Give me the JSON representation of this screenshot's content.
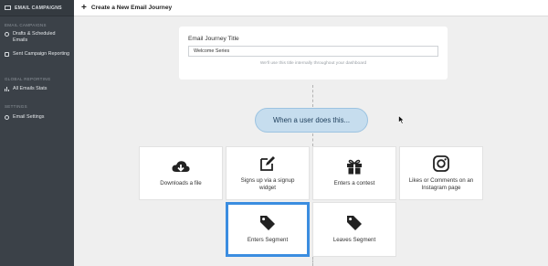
{
  "sidebar": {
    "header": "EMAIL CAMPAIGNS",
    "sections": [
      {
        "title": "EMAIL CAMPAIGNS",
        "items": [
          "Drafts & Scheduled Emails",
          "Sent Campaign Reporting"
        ]
      },
      {
        "title": "GLOBAL REPORTING",
        "items": [
          "All Emails Stats"
        ]
      },
      {
        "title": "SETTINGS",
        "items": [
          "Email Settings"
        ]
      }
    ]
  },
  "topbar": {
    "title": "Create a New Email Journey",
    "icon": "plus-icon"
  },
  "journey_title": {
    "label": "Email Journey Title",
    "value": "Welcome Series",
    "hint": "We'll use this title internally throughout your dashboard"
  },
  "trigger": {
    "label": "When a user does this..."
  },
  "options": [
    {
      "label": "Downloads a file",
      "icon": "cloud-download-icon"
    },
    {
      "label": "Signs up via a signup widget",
      "icon": "edit-icon"
    },
    {
      "label": "Enters a contest",
      "icon": "gift-icon"
    },
    {
      "label": "Likes or Comments on an Instagram page",
      "icon": "instagram-icon"
    },
    {
      "label": "Enters Segment",
      "icon": "tag-icon",
      "selected": true
    },
    {
      "label": "Leaves Segment",
      "icon": "tag-icon"
    }
  ],
  "colors": {
    "accent": "#3b8de0",
    "sidebar": "#3b4148",
    "pill": "#c6ddee"
  }
}
